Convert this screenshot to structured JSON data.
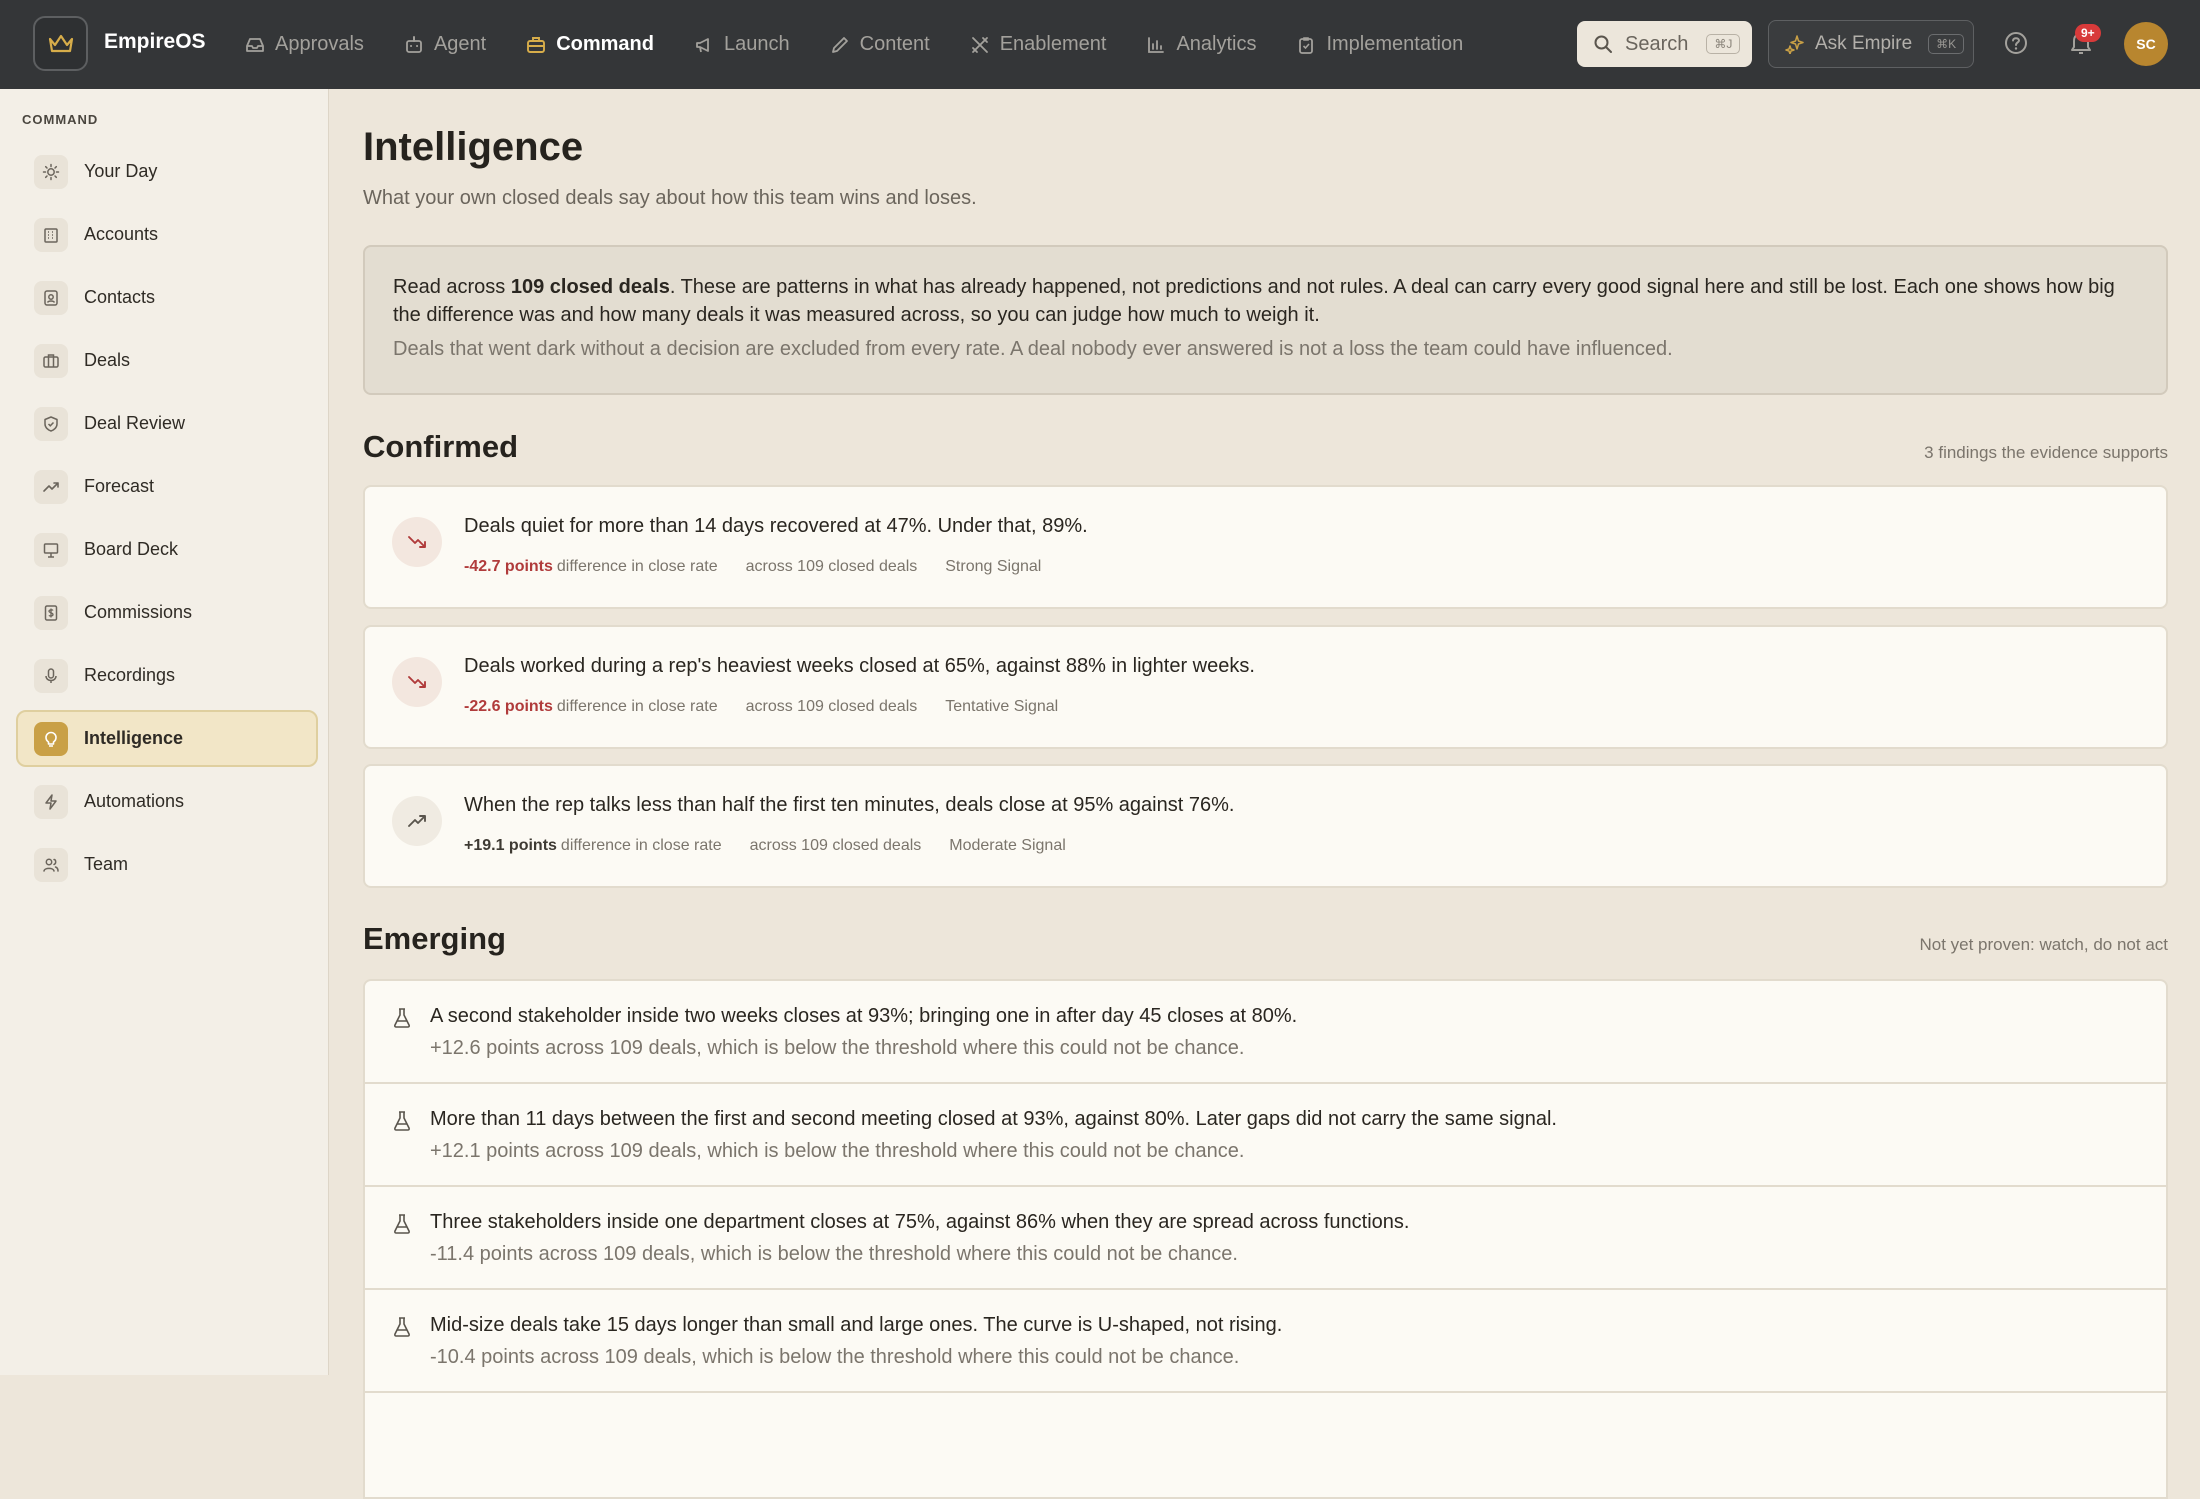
{
  "app": {
    "brand": "EmpireOS",
    "nav": [
      {
        "label": "Approvals",
        "icon": "inbox-icon"
      },
      {
        "label": "Agent",
        "icon": "robot-icon"
      },
      {
        "label": "Command",
        "icon": "briefcase-icon",
        "active": true
      },
      {
        "label": "Launch",
        "icon": "megaphone-icon"
      },
      {
        "label": "Content",
        "icon": "pencil-icon"
      },
      {
        "label": "Enablement",
        "icon": "tools-icon"
      },
      {
        "label": "Analytics",
        "icon": "bar-chart-icon"
      },
      {
        "label": "Implementation",
        "icon": "clipboard-icon"
      }
    ],
    "search": {
      "label": "Search",
      "shortcut": "⌘J"
    },
    "ask": {
      "label": "Ask Empire",
      "shortcut": "⌘K"
    },
    "notifications_badge": "9+",
    "avatar_initials": "SC"
  },
  "sidebar": {
    "heading": "COMMAND",
    "items": [
      {
        "label": "Your Day",
        "icon": "sun-icon"
      },
      {
        "label": "Accounts",
        "icon": "building-icon"
      },
      {
        "label": "Contacts",
        "icon": "contact-card-icon"
      },
      {
        "label": "Deals",
        "icon": "briefcase-icon"
      },
      {
        "label": "Deal Review",
        "icon": "shield-check-icon"
      },
      {
        "label": "Forecast",
        "icon": "trend-up-icon"
      },
      {
        "label": "Board Deck",
        "icon": "presentation-icon"
      },
      {
        "label": "Commissions",
        "icon": "dollar-doc-icon"
      },
      {
        "label": "Recordings",
        "icon": "microphone-icon"
      },
      {
        "label": "Intelligence",
        "icon": "lightbulb-icon",
        "active": true
      },
      {
        "label": "Automations",
        "icon": "lightning-icon"
      },
      {
        "label": "Team",
        "icon": "users-icon"
      }
    ]
  },
  "page": {
    "title": "Intelligence",
    "subtitle": "What your own closed deals say about how this team wins and loses.",
    "intro_prefix": "Read across ",
    "intro_bold": "109 closed deals",
    "intro_rest": ". These are patterns in what has already happened, not predictions and not rules. A deal can carry every good signal here and still be lost. Each one shows how big the difference was and how many deals it was measured across, so you can judge how much to weigh it.",
    "intro_note": "Deals that went dark without a decision are excluded from every rate. A deal nobody ever answered is not a loss the team could have influenced."
  },
  "confirmed": {
    "title": "Confirmed",
    "meta": "3 findings the evidence supports",
    "findings": [
      {
        "text": "Deals quiet for more than 14 days recovered at 47%. Under that, 89%.",
        "delta": "-42.7 points",
        "delta_label": "difference in close rate",
        "sample": "across 109 closed deals",
        "strength": "Strong Signal",
        "direction": "down"
      },
      {
        "text": "Deals worked during a rep's heaviest weeks closed at 65%, against 88% in lighter weeks.",
        "delta": "-22.6 points",
        "delta_label": "difference in close rate",
        "sample": "across 109 closed deals",
        "strength": "Tentative Signal",
        "direction": "down"
      },
      {
        "text": "When the rep talks less than half the first ten minutes, deals close at 95% against 76%.",
        "delta": "+19.1 points",
        "delta_label": "difference in close rate",
        "sample": "across 109 closed deals",
        "strength": "Moderate Signal",
        "direction": "up"
      }
    ]
  },
  "emerging": {
    "title": "Emerging",
    "meta": "Not yet proven: watch, do not act",
    "items": [
      {
        "text": "A second stakeholder inside two weeks closes at 93%; bringing one in after day 45 closes at 80%.",
        "note": "+12.6 points across 109 deals, which is below the threshold where this could not be chance."
      },
      {
        "text": "More than 11 days between the first and second meeting closed at 93%, against 80%. Later gaps did not carry the same signal.",
        "note": "+12.1 points across 109 deals, which is below the threshold where this could not be chance."
      },
      {
        "text": "Three stakeholders inside one department closes at 75%, against 86% when they are spread across functions.",
        "note": "-11.4 points across 109 deals, which is below the threshold where this could not be chance."
      },
      {
        "text": "Mid-size deals take 15 days longer than small and large ones. The curve is U-shaped, not rising.",
        "note": "-10.4 points across 109 deals, which is below the threshold where this could not be chance."
      }
    ]
  },
  "colors": {
    "accent": "#c9a046",
    "negative": "#b03b3b",
    "topbar": "#343638"
  }
}
